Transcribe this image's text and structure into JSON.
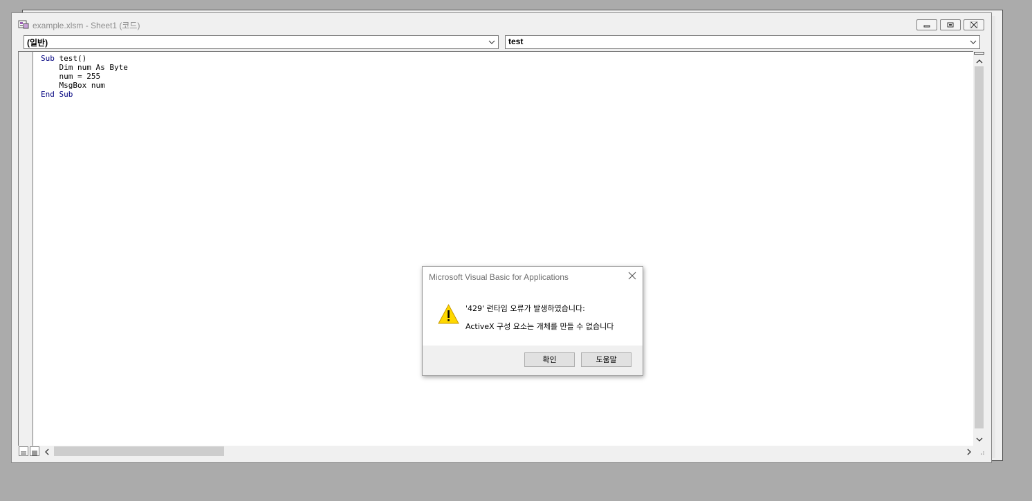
{
  "window": {
    "title": "example.xlsm - Sheet1 (코드)",
    "icon": "vba-module-icon",
    "caption_buttons": [
      "minimize",
      "restore",
      "close"
    ]
  },
  "combos": {
    "object": "(일반)",
    "procedure": "test"
  },
  "code_lines": [
    {
      "kw1": "Sub",
      "rest": " test()"
    },
    {
      "kw1": "",
      "rest": "    Dim num As Byte"
    },
    {
      "kw1": "",
      "rest": "    num = 255"
    },
    {
      "kw1": "",
      "rest": "    MsgBox num"
    },
    {
      "kw1": "End",
      "kw2": "Sub",
      "rest": ""
    }
  ],
  "dialog": {
    "title": "Microsoft Visual Basic for Applications",
    "message1": "'429' 런타임 오류가 발생하였습니다:",
    "message2": "ActiveX 구성 요소는 개체를 만들 수 없습니다",
    "icon": "warning-icon",
    "ok_label": "확인",
    "help_label": "도움말"
  },
  "colors": {
    "keyword": "#00007f",
    "desktop": "#ababab"
  }
}
